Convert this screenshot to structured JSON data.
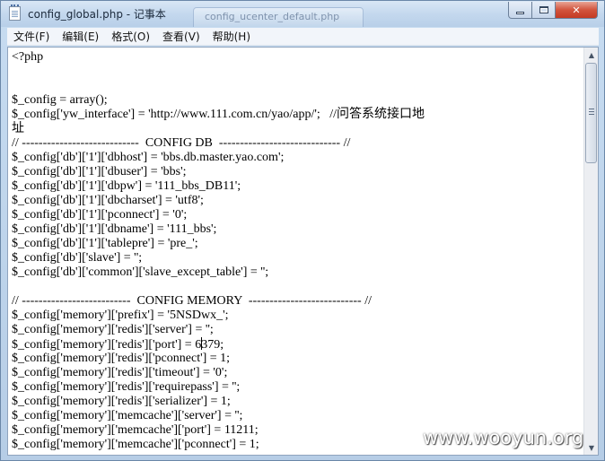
{
  "window": {
    "title": "config_global.php - 记事本",
    "background_tab_title": "config_ucenter_default.php"
  },
  "menu": [
    {
      "label": "文件(F)"
    },
    {
      "label": "编辑(E)"
    },
    {
      "label": "格式(O)"
    },
    {
      "label": "查看(V)"
    },
    {
      "label": "帮助(H)"
    }
  ],
  "editor": {
    "lines": [
      "<?php",
      "",
      "",
      "$_config = array();",
      "$_config['yw_interface'] = 'http://www.111.com.cn/yao/app/';   //问答系统接口地",
      "址",
      "// ----------------------------  CONFIG DB  ----------------------------- //",
      "$_config['db']['1']['dbhost'] = 'bbs.db.master.yao.com';",
      "$_config['db']['1']['dbuser'] = 'bbs';",
      "$_config['db']['1']['dbpw'] = '111_bbs_DB11';",
      "$_config['db']['1']['dbcharset'] = 'utf8';",
      "$_config['db']['1']['pconnect'] = '0';",
      "$_config['db']['1']['dbname'] = '111_bbs';",
      "$_config['db']['1']['tablepre'] = 'pre_';",
      "$_config['db']['slave'] = '';",
      "$_config['db']['common']['slave_except_table'] = '';",
      "",
      "// --------------------------  CONFIG MEMORY  --------------------------- //",
      "$_config['memory']['prefix'] = '5NSDwx_';",
      "$_config['memory']['redis']['server'] = '';",
      "$_config['memory']['redis']['port'] = 6379;",
      "$_config['memory']['redis']['pconnect'] = 1;",
      "$_config['memory']['redis']['timeout'] = '0';",
      "$_config['memory']['redis']['requirepass'] = '';",
      "$_config['memory']['redis']['serializer'] = 1;",
      "$_config['memory']['memcache']['server'] = '';",
      "$_config['memory']['memcache']['port'] = 11211;",
      "$_config['memory']['memcache']['pconnect'] = 1;"
    ],
    "caret": {
      "line": 20,
      "column": 39
    }
  },
  "watermark": "www.wooyun.org",
  "icons": {
    "app": "notepad-icon",
    "minimize": "minimize-icon",
    "maximize": "maximize-icon",
    "close": "close-icon"
  },
  "colors": {
    "close_button": "#c43a22",
    "titlebar": "#c4d8ee",
    "editor_bg": "#ffffff"
  }
}
